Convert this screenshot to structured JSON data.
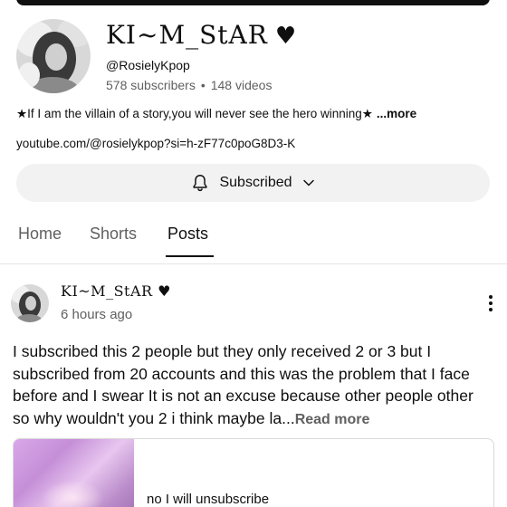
{
  "channel": {
    "name": "KI~M_StAR",
    "heart": "♥",
    "handle": "@RosielyKpop",
    "subscribers": "578 subscribers",
    "separator": "•",
    "videos": "148 videos",
    "description": "★If I am the villain of a story,you will never see the hero winning★",
    "more_label": "...more",
    "link": "youtube.com/@rosielykpop?si=h-zF77c0poG8D3-K",
    "subscribe_label": "Subscribed"
  },
  "tabs": [
    {
      "label": "Home"
    },
    {
      "label": "Shorts"
    },
    {
      "label": "Posts"
    }
  ],
  "post": {
    "author": "KI~M_StAR",
    "author_heart": "♥",
    "time": "6 hours ago",
    "text": "I subscribed this 2 people but they only received 2 or 3 but I subscribed from 20 accounts and this was the problem that I face before and I swear It is not an excuse because other people other so why wouldn't you 2 i think maybe la...",
    "read_more": "Read more",
    "poll_option": "no I will unsubscribe"
  },
  "icons": {
    "bell": "bell-icon",
    "chevron": "chevron-down-icon",
    "menu": "more-vert-icon"
  }
}
